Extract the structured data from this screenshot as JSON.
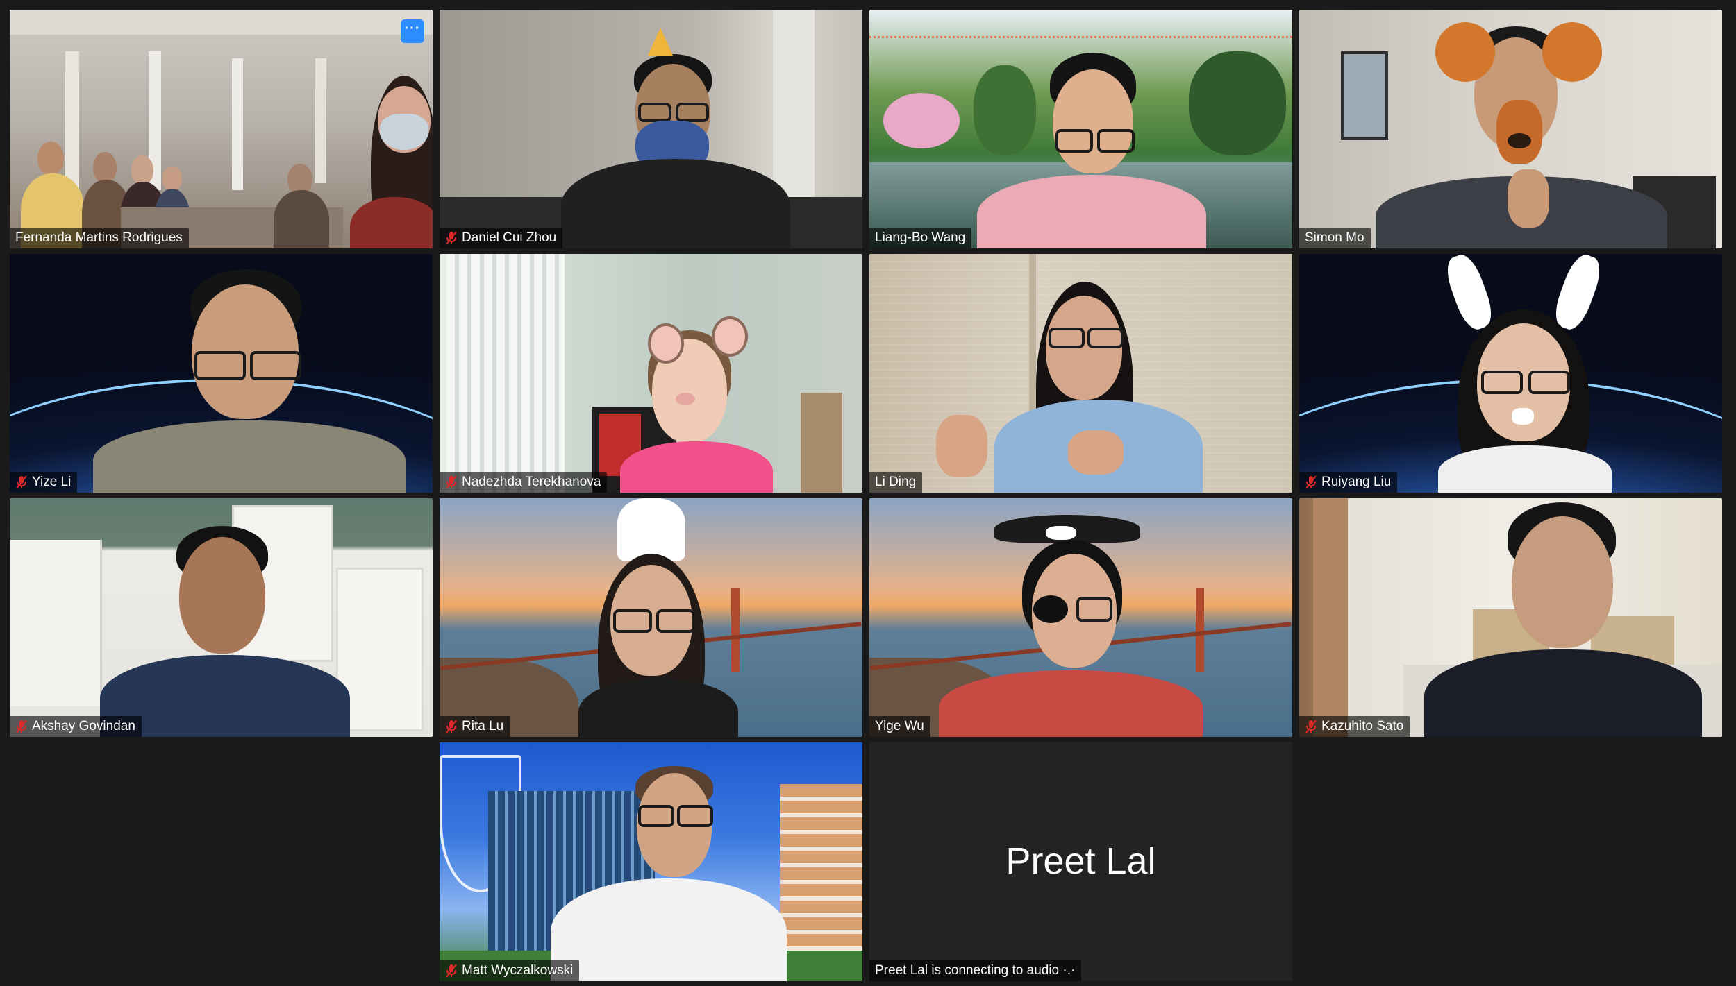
{
  "participants": [
    {
      "name": "Fernanda Martins Rodrigues",
      "muted": false,
      "active": false,
      "has_more_button": true
    },
    {
      "name": "Daniel Cui Zhou",
      "muted": true,
      "active": false
    },
    {
      "name": "Liang-Bo Wang",
      "muted": false,
      "active": false
    },
    {
      "name": "Simon Mo",
      "muted": false,
      "active": false
    },
    {
      "name": "Yize Li",
      "muted": true,
      "active": false
    },
    {
      "name": "Nadezhda Terekhanova",
      "muted": true,
      "active": false
    },
    {
      "name": "Li Ding",
      "muted": false,
      "active": true
    },
    {
      "name": "Ruiyang Liu",
      "muted": true,
      "active": false
    },
    {
      "name": "Akshay Govindan",
      "muted": true,
      "active": false
    },
    {
      "name": "Rita Lu",
      "muted": true,
      "active": false
    },
    {
      "name": "Yige Wu",
      "muted": false,
      "active": false
    },
    {
      "name": "Kazuhito Sato",
      "muted": true,
      "active": false
    },
    {
      "name": "Matt Wyczalkowski",
      "muted": true,
      "active": false
    }
  ],
  "audio_only": {
    "name": "Preet Lal",
    "status": "Preet Lal is connecting to audio ·.·"
  },
  "more_button_label": "···",
  "icons": {
    "mute": "microphone-muted-icon",
    "more": "more-options-icon"
  },
  "colors": {
    "background": "#1a1a1a",
    "active_speaker_border": "#e8e37a",
    "mute_red": "#e02828",
    "more_button": "#2d8cff"
  }
}
